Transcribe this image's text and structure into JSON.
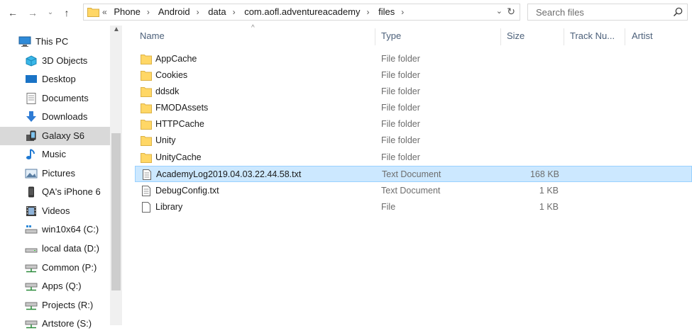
{
  "address": {
    "overflow": "«",
    "crumbs": [
      "Phone",
      "Android",
      "data",
      "com.aofl.adventureacademy",
      "files"
    ]
  },
  "search": {
    "placeholder": "Search files"
  },
  "nav": {
    "items": [
      {
        "label": "This PC",
        "icon": "pc-icon"
      },
      {
        "label": "3D Objects",
        "icon": "3d-objects-icon"
      },
      {
        "label": "Desktop",
        "icon": "desktop-icon"
      },
      {
        "label": "Documents",
        "icon": "documents-icon"
      },
      {
        "label": "Downloads",
        "icon": "downloads-icon"
      },
      {
        "label": "Galaxy S6",
        "icon": "phone-device-icon"
      },
      {
        "label": "Music",
        "icon": "music-icon"
      },
      {
        "label": "Pictures",
        "icon": "pictures-icon"
      },
      {
        "label": "QA's iPhone 6",
        "icon": "iphone-icon"
      },
      {
        "label": "Videos",
        "icon": "videos-icon"
      },
      {
        "label": "win10x64 (C:)",
        "icon": "os-drive-icon"
      },
      {
        "label": "local data (D:)",
        "icon": "drive-icon"
      },
      {
        "label": "Common (P:)",
        "icon": "network-drive-icon"
      },
      {
        "label": "Apps (Q:)",
        "icon": "network-drive-icon"
      },
      {
        "label": "Projects (R:)",
        "icon": "network-drive-icon"
      },
      {
        "label": "Artstore (S:)",
        "icon": "network-drive-icon"
      }
    ]
  },
  "columns": {
    "name": "Name",
    "type": "Type",
    "size": "Size",
    "track": "Track Nu...",
    "artist": "Artist"
  },
  "files": [
    {
      "name": "AppCache",
      "type": "File folder",
      "size": "",
      "icon": "folder-icon"
    },
    {
      "name": "Cookies",
      "type": "File folder",
      "size": "",
      "icon": "folder-icon"
    },
    {
      "name": "ddsdk",
      "type": "File folder",
      "size": "",
      "icon": "folder-icon"
    },
    {
      "name": "FMODAssets",
      "type": "File folder",
      "size": "",
      "icon": "folder-icon"
    },
    {
      "name": "HTTPCache",
      "type": "File folder",
      "size": "",
      "icon": "folder-icon"
    },
    {
      "name": "Unity",
      "type": "File folder",
      "size": "",
      "icon": "folder-icon"
    },
    {
      "name": "UnityCache",
      "type": "File folder",
      "size": "",
      "icon": "folder-icon"
    },
    {
      "name": "AcademyLog2019.04.03.22.44.58.txt",
      "type": "Text Document",
      "size": "168 KB",
      "icon": "text-file-icon"
    },
    {
      "name": "DebugConfig.txt",
      "type": "Text Document",
      "size": "1 KB",
      "icon": "text-file-icon"
    },
    {
      "name": "Library",
      "type": "File",
      "size": "1 KB",
      "icon": "file-icon"
    }
  ],
  "colors": {
    "selection_bg": "#cce8ff",
    "selection_border": "#99d1ff",
    "folder_yellow": "#ffd766",
    "header_text": "#4c607a"
  }
}
